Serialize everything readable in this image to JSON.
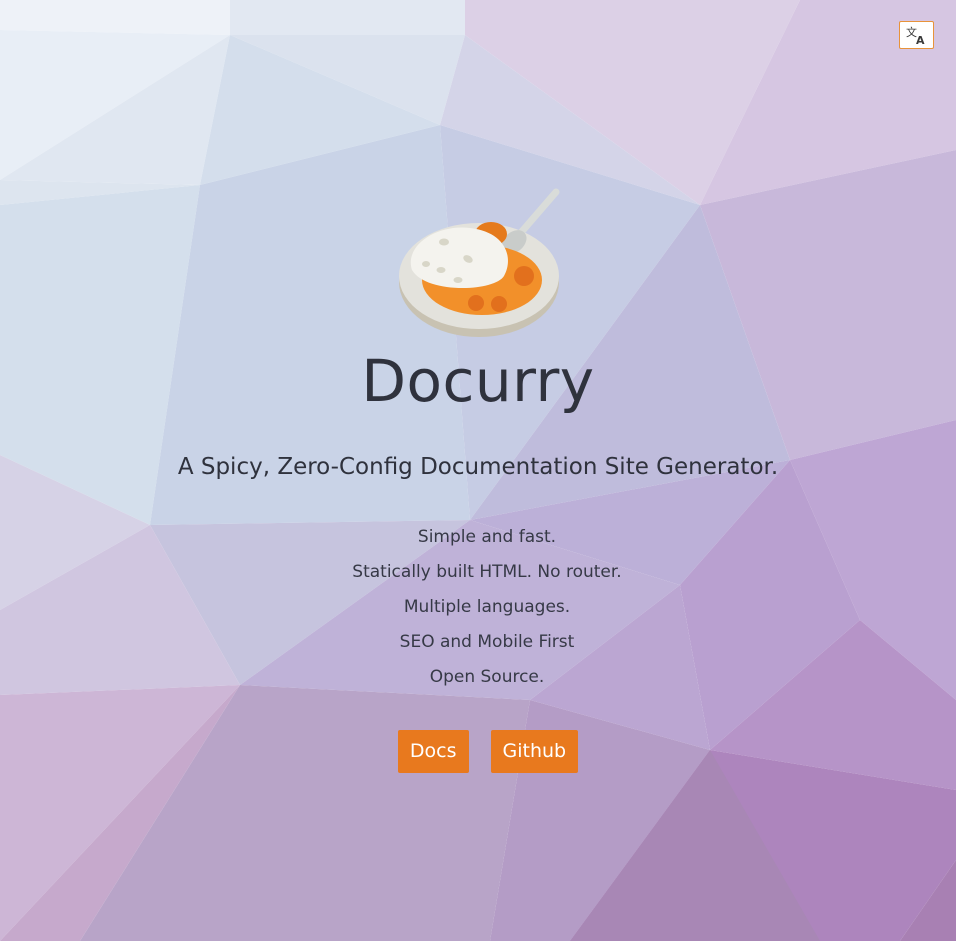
{
  "header": {
    "language_icon": "translate-icon"
  },
  "hero": {
    "logo_icon": "curry-rice-icon",
    "title": "Docurry",
    "tagline": "A Spicy, Zero-Config Documentation Site Generator.",
    "features": [
      "Simple and fast.",
      "Statically built HTML. No router.",
      "Multiple languages.",
      "SEO and Mobile First",
      "Open Source."
    ],
    "buttons": {
      "docs_label": "Docs",
      "github_label": "Github"
    }
  },
  "colors": {
    "accent": "#e8791e",
    "text": "#2f323d"
  }
}
